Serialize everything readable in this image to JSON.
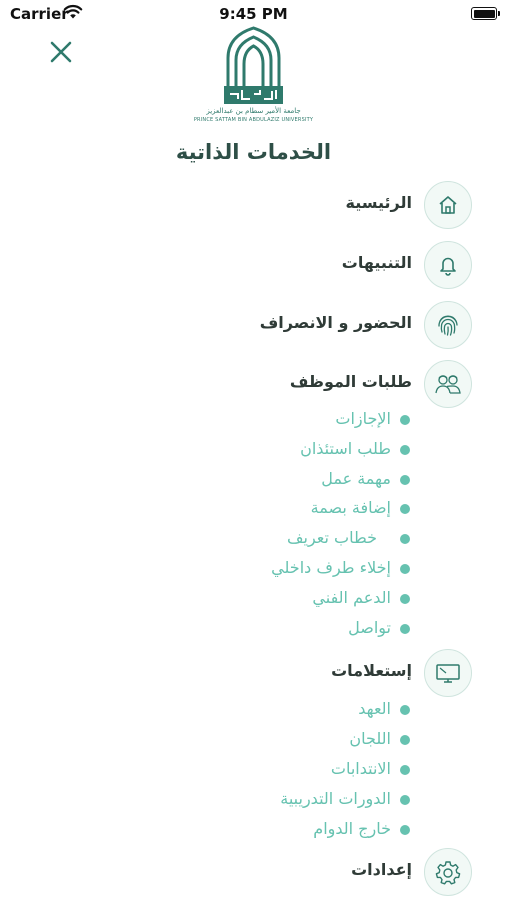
{
  "status_bar": {
    "carrier": "Carrier",
    "time": "9:45 PM"
  },
  "logo": {
    "arabic_name": "جامعة الأمير سطام بن عبدالعزيز",
    "english_name": "PRINCE SATTAM BIN ABDULAZIZ UNIVERSITY"
  },
  "page": {
    "title": "الخدمات الذاتية"
  },
  "menu": {
    "home": {
      "label": "الرئيسية",
      "icon": "home-icon"
    },
    "notifications": {
      "label": "التنبيهات",
      "icon": "bell-icon"
    },
    "attendance": {
      "label": "الحضور و الانصراف",
      "icon": "fingerprint-icon"
    },
    "employee_requests": {
      "label": "طلبات الموظف",
      "icon": "employees-icon",
      "items": [
        "الإجازات",
        "طلب استئذان",
        "مهمة عمل",
        "إضافة بصمة",
        "خطاب تعريف",
        "إخلاء طرف داخلي",
        "الدعم الفني",
        "تواصل"
      ]
    },
    "inquiries": {
      "label": "إستعلامات",
      "icon": "monitor-icon",
      "items": [
        "العهد",
        "اللجان",
        "الانتدابات",
        "الدورات التدريبية",
        "خارج الدوام"
      ]
    },
    "settings": {
      "label": "إعدادات",
      "icon": "gear-icon"
    }
  },
  "colors": {
    "primary": "#2f7a6c",
    "accent": "#66c2b0",
    "icon_bg": "#f2f9f6",
    "title": "#2e4f47"
  }
}
